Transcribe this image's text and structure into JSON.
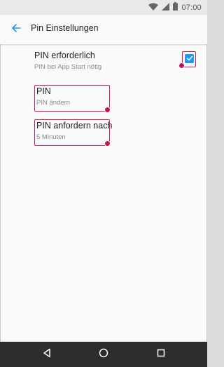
{
  "status_bar": {
    "time": "07:00",
    "icons": [
      "wifi-icon",
      "signal-icon",
      "battery-icon"
    ]
  },
  "app_bar": {
    "back_icon": "arrow-left-icon",
    "title": "Pin Einstellungen"
  },
  "settings": [
    {
      "id": "pin-required",
      "title": "PIN erforderlich",
      "summary": "PIN bei App Start nötig",
      "control": "checkbox",
      "checked": true
    },
    {
      "id": "pin",
      "title": "PIN",
      "summary": "PIN ändern"
    },
    {
      "id": "pin-delay",
      "title": "PIN anfordern nach",
      "summary": "5 Minuten"
    }
  ],
  "nav_bar": {
    "icons": [
      "nav-back-icon",
      "nav-home-icon",
      "nav-recents-icon"
    ]
  },
  "colors": {
    "accent": "#2196f3",
    "highlight": "#d81b4d",
    "nav_background": "#2d2d2d",
    "status_background": "#e9e9e9"
  }
}
